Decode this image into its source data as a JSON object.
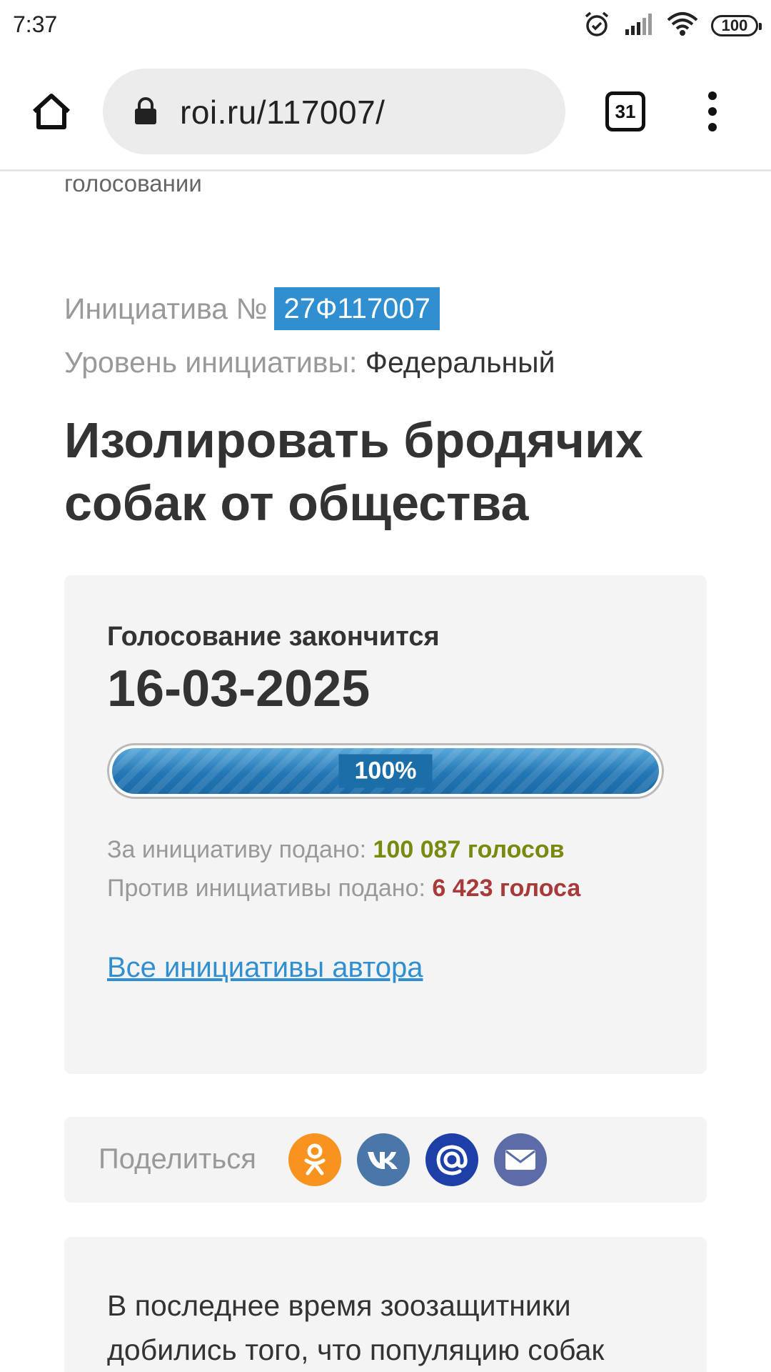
{
  "status_bar": {
    "time": "7:37",
    "battery": "100",
    "icons": [
      "alarm-icon",
      "signal-icon",
      "wifi-icon",
      "battery-icon"
    ]
  },
  "browser": {
    "url": "roi.ru/117007/",
    "tabs_count": "31",
    "icons": [
      "home-icon",
      "lock-icon",
      "tabs-icon",
      "more-vert-icon"
    ]
  },
  "page": {
    "cut_text": "голосовании",
    "initiative_label": "Инициатива №",
    "initiative_id": "27Ф117007",
    "level_label": "Уровень инициативы:",
    "level_value": "Федеральный",
    "title": "Изолировать бродячих собак от общества"
  },
  "vote": {
    "end_label": "Голосование закончится",
    "end_date": "16-03-2025",
    "progress_label": "100%",
    "progress_fraction": 1.0,
    "for_label": "За инициативу подано:",
    "for_value": "100 087 голосов",
    "for_color": "#7a8a10",
    "against_label": "Против инициативы подано:",
    "against_value": "6 423 голоса",
    "against_color": "#a83a3a",
    "author_link": "Все инициативы автора"
  },
  "share": {
    "label": "Поделиться",
    "icons": [
      "odnoklassniki-icon",
      "vk-icon",
      "mailru-icon",
      "email-icon"
    ]
  },
  "description": {
    "text": "В последнее время зоозащитники добились того, что популяцию собак"
  },
  "colors": {
    "accent": "#2f8fd1",
    "card_bg": "#f4f4f4"
  }
}
